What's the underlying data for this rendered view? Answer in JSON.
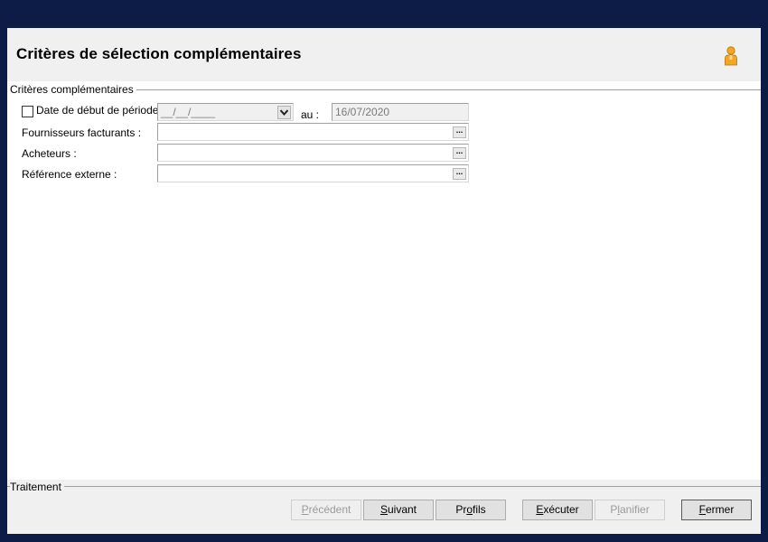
{
  "header": {
    "title": "Critères de sélection complémentaires"
  },
  "group": {
    "title": "Critères complémentaires"
  },
  "fields": {
    "date_start": {
      "label": "Date de début de période",
      "value": "__/__/____",
      "checked": false
    },
    "date_sep": "au :",
    "date_end": {
      "value": "16/07/2020"
    },
    "fournisseurs": {
      "label": "Fournisseurs facturants :",
      "value": ""
    },
    "acheteurs": {
      "label": "Acheteurs :",
      "value": ""
    },
    "reference": {
      "label": "Référence externe :",
      "value": ""
    },
    "ellipsis": "..."
  },
  "footer": {
    "title": "Traitement"
  },
  "buttons": {
    "precedent": {
      "pre": "",
      "key": "P",
      "post": "récédent",
      "enabled": false
    },
    "suivant": {
      "pre": "",
      "key": "S",
      "post": "uivant",
      "enabled": true
    },
    "profils": {
      "pre": "Pr",
      "key": "o",
      "post": "fils",
      "enabled": true
    },
    "executer": {
      "pre": "",
      "key": "E",
      "post": "xécuter",
      "enabled": true
    },
    "planifier": {
      "pre": "P",
      "key": "l",
      "post": "anifier",
      "enabled": false
    },
    "fermer": {
      "pre": "",
      "key": "F",
      "post": "ermer",
      "enabled": true
    }
  },
  "colors": {
    "background": "#0c1c46",
    "panel": "#f0f0f0",
    "user_icon": "#f4a623"
  },
  "icons": {
    "user": "user-icon",
    "combo": "chevron-down-icon"
  }
}
